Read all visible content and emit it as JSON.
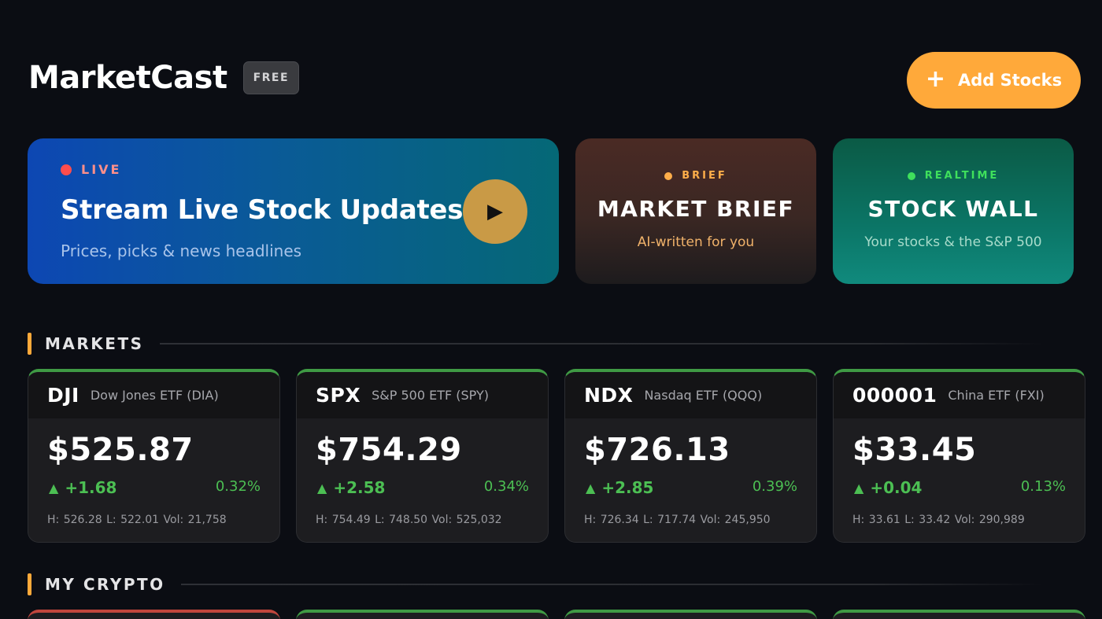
{
  "header": {
    "title": "MarketCast",
    "badge": "FREE",
    "add_button": "Add Stocks"
  },
  "live_card": {
    "tag": "LIVE",
    "title": "Stream Live Stock Updates",
    "subtitle": "Prices, picks & news headlines"
  },
  "brief_card": {
    "tag": "BRIEF",
    "title": "MARKET BRIEF",
    "subtitle": "AI-written for you"
  },
  "wall_card": {
    "tag": "REALTIME",
    "title": "STOCK WALL",
    "subtitle": "Your stocks & the S&P 500"
  },
  "sections": {
    "markets": "MARKETS",
    "crypto": "MY CRYPTO"
  },
  "markets": [
    {
      "symbol": "DJI",
      "name": "Dow Jones ETF (DIA)",
      "price": "$525.87",
      "change": "+1.68",
      "percent": "0.32%",
      "stats": "H: 526.28  L: 522.01  Vol: 21,758"
    },
    {
      "symbol": "SPX",
      "name": "S&P 500 ETF (SPY)",
      "price": "$754.29",
      "change": "+2.58",
      "percent": "0.34%",
      "stats": "H: 754.49  L: 748.50  Vol: 525,032"
    },
    {
      "symbol": "NDX",
      "name": "Nasdaq ETF (QQQ)",
      "price": "$726.13",
      "change": "+2.85",
      "percent": "0.39%",
      "stats": "H: 726.34  L: 717.74  Vol: 245,950"
    },
    {
      "symbol": "000001",
      "name": "China ETF (FXI)",
      "price": "$33.45",
      "change": "+0.04",
      "percent": "0.13%",
      "stats": "H: 33.61  L: 33.42  Vol: 290,989"
    }
  ],
  "colors": {
    "accent": "#ffa93a",
    "up": "#4cbf53",
    "down": "#c0463d"
  }
}
